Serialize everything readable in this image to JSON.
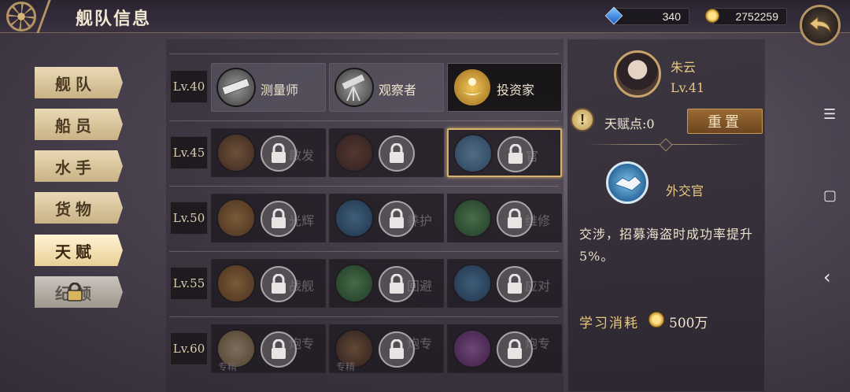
{
  "header": {
    "title": "舰队信息",
    "gems": "340",
    "gold": "2752259"
  },
  "tabs": [
    {
      "label": "舰队",
      "state": "normal"
    },
    {
      "label": "船员",
      "state": "normal"
    },
    {
      "label": "水手",
      "state": "normal"
    },
    {
      "label": "货物",
      "state": "normal"
    },
    {
      "label": "天赋",
      "state": "active"
    },
    {
      "label": "纪领",
      "state": "locked"
    }
  ],
  "talent_rows": [
    {
      "level": "Lv.40",
      "skills": [
        {
          "name": "测量师",
          "locked": false
        },
        {
          "name": "观察者",
          "locked": false
        },
        {
          "name": "投资家",
          "locked": false
        }
      ]
    },
    {
      "level": "Lv.45",
      "skills": [
        {
          "name": "散发",
          "locked": true
        },
        {
          "name": "",
          "locked": true
        },
        {
          "name": "官",
          "locked": true
        }
      ]
    },
    {
      "level": "Lv.50",
      "skills": [
        {
          "name": "光辉",
          "locked": true
        },
        {
          "name": "养护",
          "locked": true
        },
        {
          "name": "维修",
          "locked": true
        }
      ]
    },
    {
      "level": "Lv.55",
      "skills": [
        {
          "name": "战舰",
          "locked": true
        },
        {
          "name": "回避",
          "locked": true
        },
        {
          "name": "应对",
          "locked": true
        }
      ]
    },
    {
      "level": "Lv.60",
      "skills": [
        {
          "name": "炮专",
          "tag": "专精",
          "locked": true
        },
        {
          "name": "炮专",
          "tag": "专精",
          "locked": true
        },
        {
          "name": "炮专",
          "locked": true
        }
      ]
    }
  ],
  "character": {
    "name": "朱云",
    "level": "Lv.41"
  },
  "talent_points_label": "天赋点:0",
  "reset_label": "重置",
  "selected_talent": {
    "name": "外交官",
    "description": "交涉，招募海盗时成功率提升5%。"
  },
  "cost": {
    "label": "学习消耗",
    "value": "500万"
  },
  "system_nav": {
    "menu": "☰",
    "home": "▢",
    "back": "‹"
  }
}
